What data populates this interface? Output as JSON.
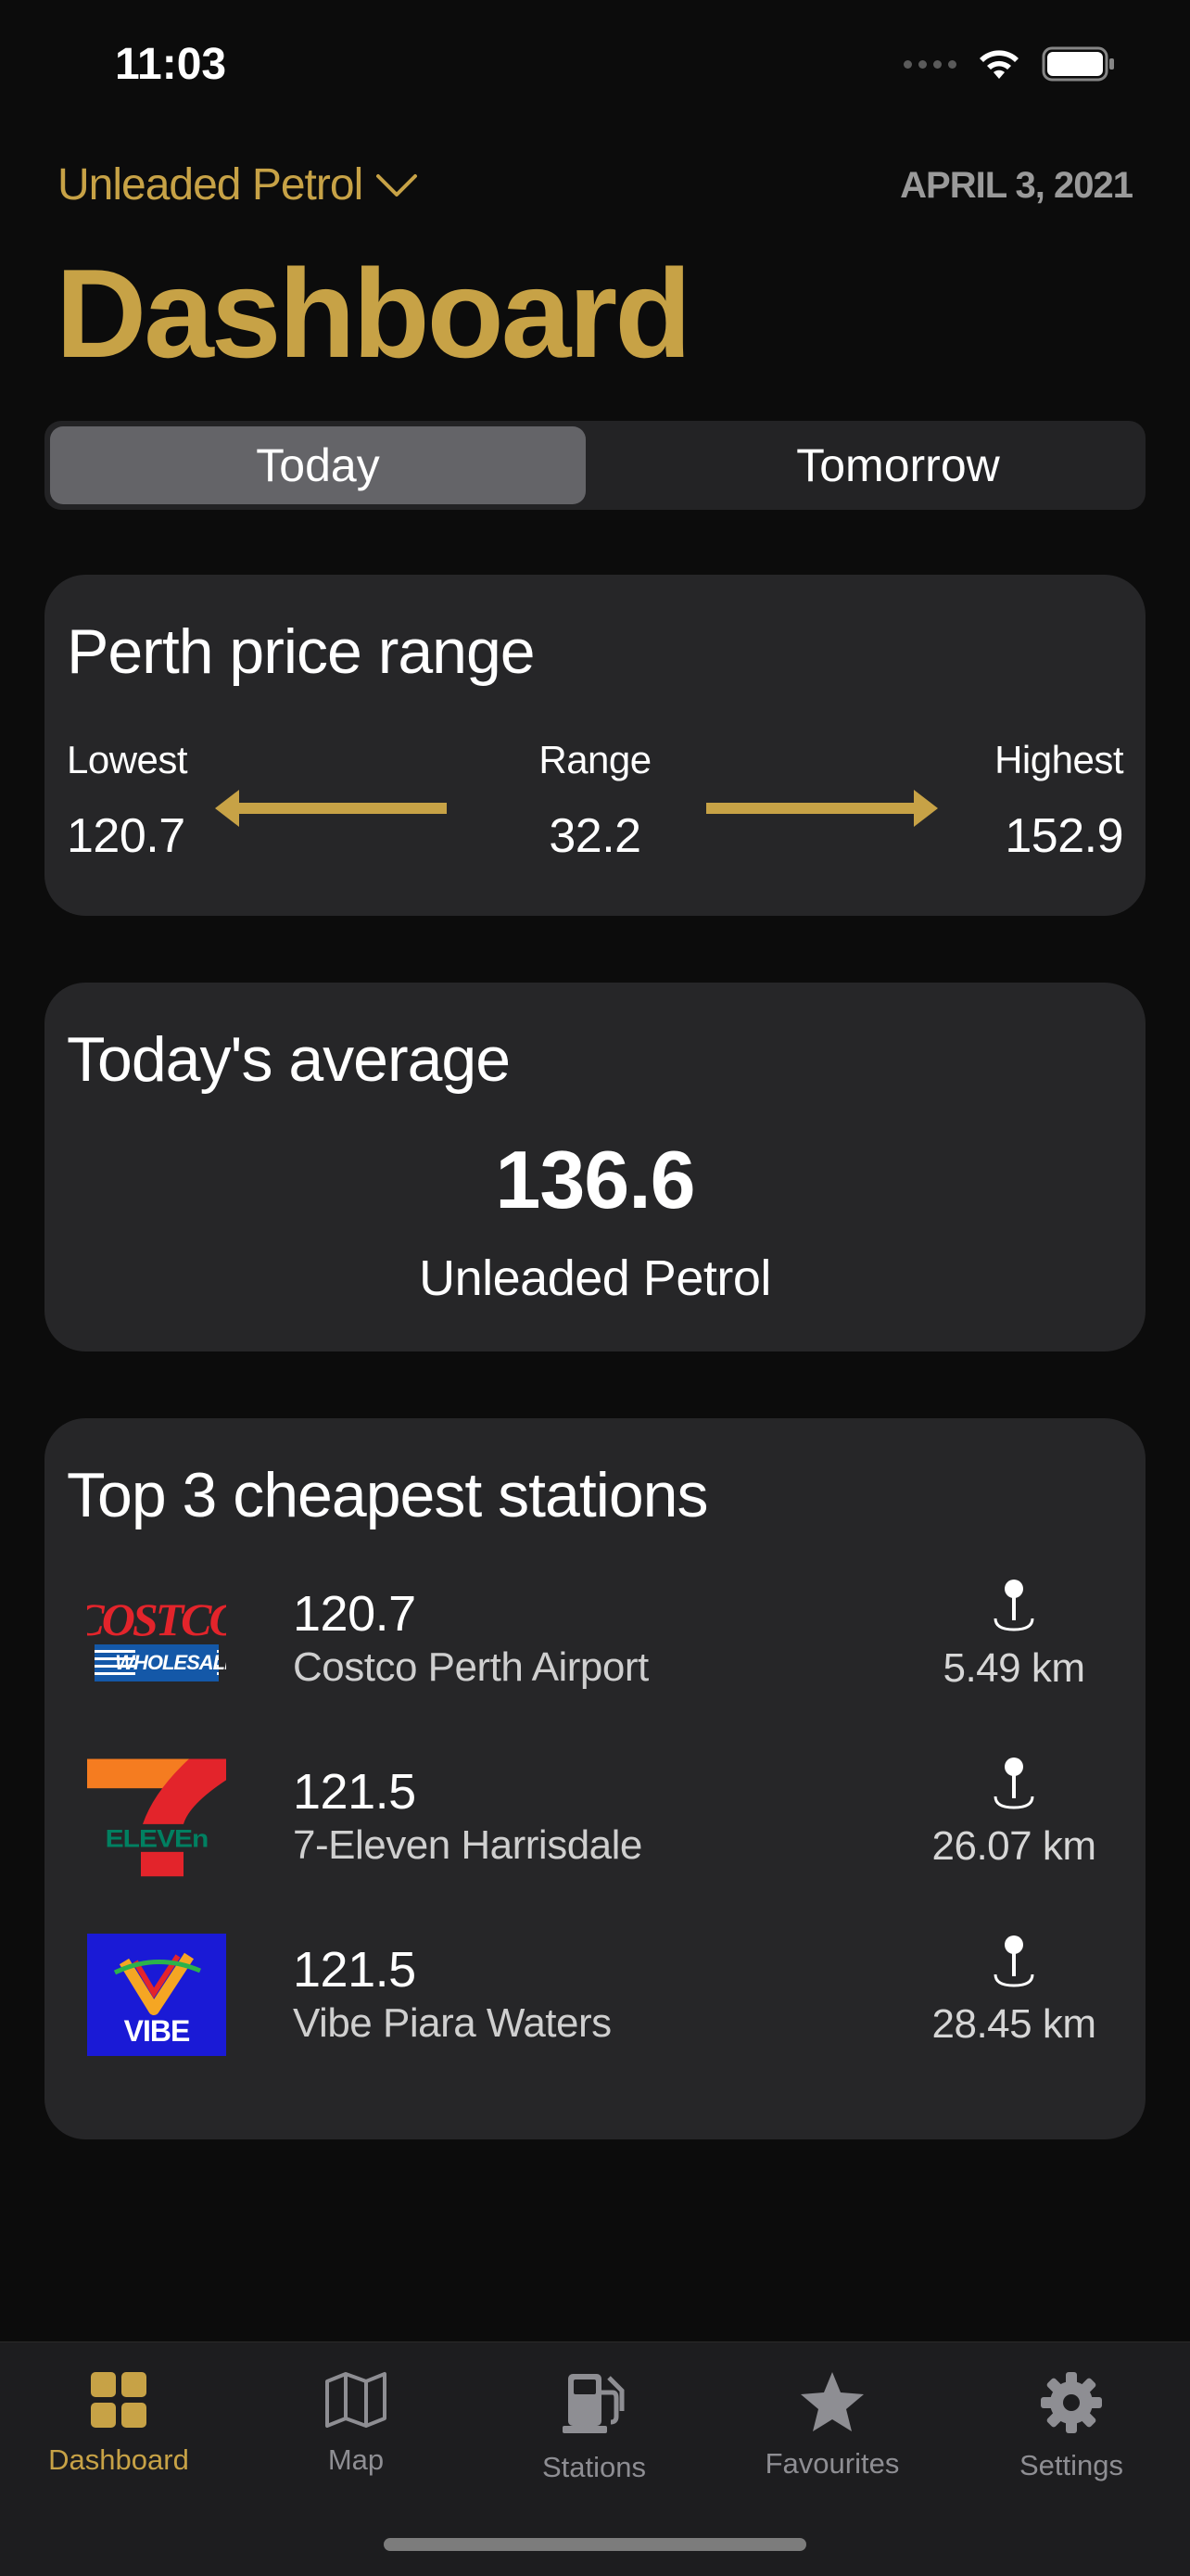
{
  "status_bar": {
    "time": "11:03"
  },
  "header": {
    "fuel_type": "Unleaded Petrol",
    "date": "APRIL 3, 2021",
    "title": "Dashboard"
  },
  "segmented": {
    "today": "Today",
    "tomorrow": "Tomorrow",
    "selected": "Today"
  },
  "price_range": {
    "title": "Perth price range",
    "lowest_label": "Lowest",
    "lowest_value": "120.7",
    "range_label": "Range",
    "range_value": "32.2",
    "highest_label": "Highest",
    "highest_value": "152.9"
  },
  "average": {
    "title": "Today's average",
    "value": "136.6",
    "fuel": "Unleaded Petrol"
  },
  "top_stations": {
    "title": "Top 3 cheapest stations",
    "items": [
      {
        "price": "120.7",
        "name": "Costco Perth Airport",
        "distance": "5.49 km",
        "logo": "costco-logo"
      },
      {
        "price": "121.5",
        "name": "7-Eleven Harrisdale",
        "distance": "26.07 km",
        "logo": "7-eleven-logo"
      },
      {
        "price": "121.5",
        "name": "Vibe Piara Waters",
        "distance": "28.45 km",
        "logo": "vibe-logo"
      }
    ]
  },
  "tabbar": {
    "items": [
      {
        "label": "Dashboard",
        "icon": "dashboard-grid-icon",
        "active": true
      },
      {
        "label": "Map",
        "icon": "map-icon",
        "active": false
      },
      {
        "label": "Stations",
        "icon": "fuel-pump-icon",
        "active": false
      },
      {
        "label": "Favourites",
        "icon": "star-icon",
        "active": false
      },
      {
        "label": "Settings",
        "icon": "gear-icon",
        "active": false
      }
    ]
  },
  "colors": {
    "accent": "#c7a246",
    "background": "#0c0c0c",
    "card": "#262628"
  }
}
